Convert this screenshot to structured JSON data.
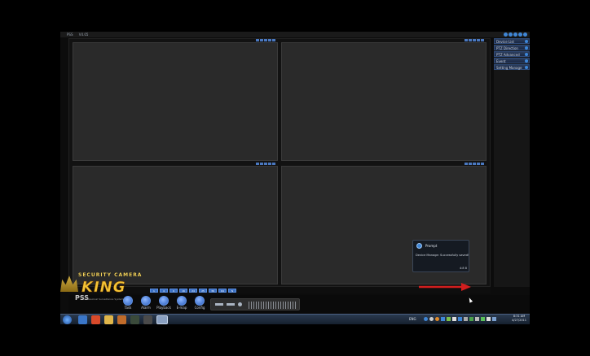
{
  "app": {
    "title_menu": [
      "PSS",
      "V4.05"
    ]
  },
  "right_panel": {
    "items": [
      {
        "label": "Device List"
      },
      {
        "label": "PTZ Direction"
      },
      {
        "label": "PTZ Advanced"
      },
      {
        "label": "Event"
      },
      {
        "label": "Setting Manage"
      }
    ]
  },
  "view_tabs": [
    "1",
    "4",
    "9",
    "16",
    "24",
    "25",
    "36",
    "64",
    "N"
  ],
  "toolbar": {
    "tools": [
      {
        "label": "Task",
        "icon": "task-icon"
      },
      {
        "label": "Alarm",
        "icon": "alarm-icon"
      },
      {
        "label": "Playback",
        "icon": "playback-icon"
      },
      {
        "label": "E-map",
        "icon": "emap-icon"
      },
      {
        "label": "Config",
        "icon": "config-icon"
      }
    ]
  },
  "logo": {
    "line1": "SECURITY CAMERA",
    "line2": "KING",
    "line3": "PSS",
    "line4": "Professional Surveillance System"
  },
  "popup": {
    "title": "Prompt",
    "message": "Device Manage: Successfully saved!",
    "footer": "4:8 8"
  },
  "taskbar": {
    "lang": "ENG",
    "time": "8:31 AM",
    "date": "4/27/2011"
  },
  "colors": {
    "accent": "#3f86d6",
    "pane_bg": "#2a2a2a",
    "arrow": "#d11e1e",
    "logo_gold": "#f3c335"
  }
}
